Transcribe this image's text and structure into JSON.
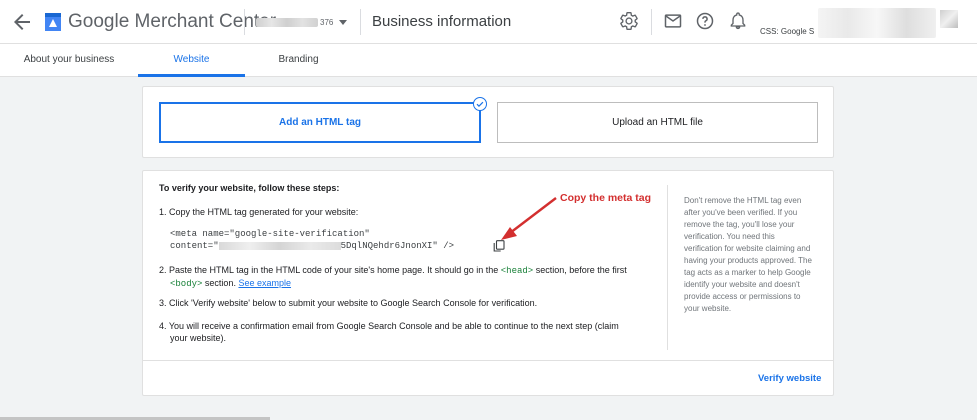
{
  "header": {
    "brand": "Google Merchant Center",
    "account_id_suffix": "376",
    "page_title": "Business information",
    "css_label": "CSS: Google S",
    "icons": [
      "back-arrow-icon",
      "merchant-logo-icon",
      "settings-icon",
      "mail-icon",
      "help-icon",
      "bell-icon",
      "avatar"
    ]
  },
  "tabs": [
    {
      "label": "About your business",
      "active": false
    },
    {
      "label": "Website",
      "active": true
    },
    {
      "label": "Branding",
      "active": false
    }
  ],
  "method": {
    "options": [
      "Add an HTML tag",
      "Upload an HTML file"
    ],
    "selected": "Add an HTML tag"
  },
  "verify": {
    "title": "To verify your website, follow these steps:",
    "step1": "1. Copy the HTML tag generated for your website:",
    "snippet_line1": "<meta name=\"google-site-verification\"",
    "snippet_line2_start": "content=\"",
    "snippet_line2_end": "5DqlNQehdr6JnonXI\" />",
    "step2_a": "2. Paste the HTML tag in the HTML code of your site's home page. It should go in the",
    "step2_head": "<head>",
    "step2_b": "section, before the first",
    "step2_body": "<body>",
    "step2_c": "section.",
    "step2_link": "See example",
    "step3": "3. Click 'Verify website' below to submit your website to Google Search Console for verification.",
    "step4_a": "4. You will receive a confirmation email from Google Search Console and be able to continue to the next step (claim",
    "step4_b": "your website).",
    "side_note": "Don't remove the HTML tag even after you've been verified. If you remove the tag, you'll lose your verification. You need this verification for website claiming and having your products approved. The tag acts as a marker to help Google identify your website and doesn't provide access or permissions to your website.",
    "verify_button": "Verify website"
  },
  "annotation": {
    "text": "Copy the meta tag",
    "color": "#d32f2f"
  },
  "colors": {
    "accent": "#1a73e8",
    "background": "#f1f3f4",
    "annotation": "#d32f2f"
  }
}
